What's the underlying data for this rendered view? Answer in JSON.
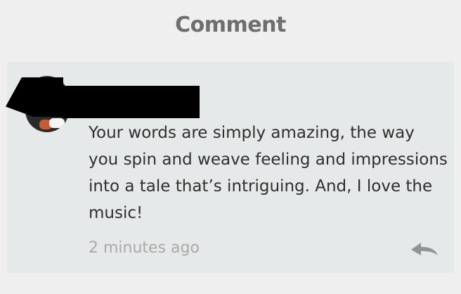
{
  "header": {
    "title": "Comment"
  },
  "comment": {
    "text": "Your words are simply amazing, the way you spin and weave feeling and impressions into a tale that’s intriguing. And, I love the music!",
    "timestamp": "2 minutes ago",
    "reply_icon": "reply-icon"
  },
  "colors": {
    "background": "#efefef",
    "card": "#e6e9e9",
    "title": "#6e6e6e",
    "text": "#2f2f2f",
    "muted": "#a9a9a9",
    "redaction": "#000000"
  }
}
